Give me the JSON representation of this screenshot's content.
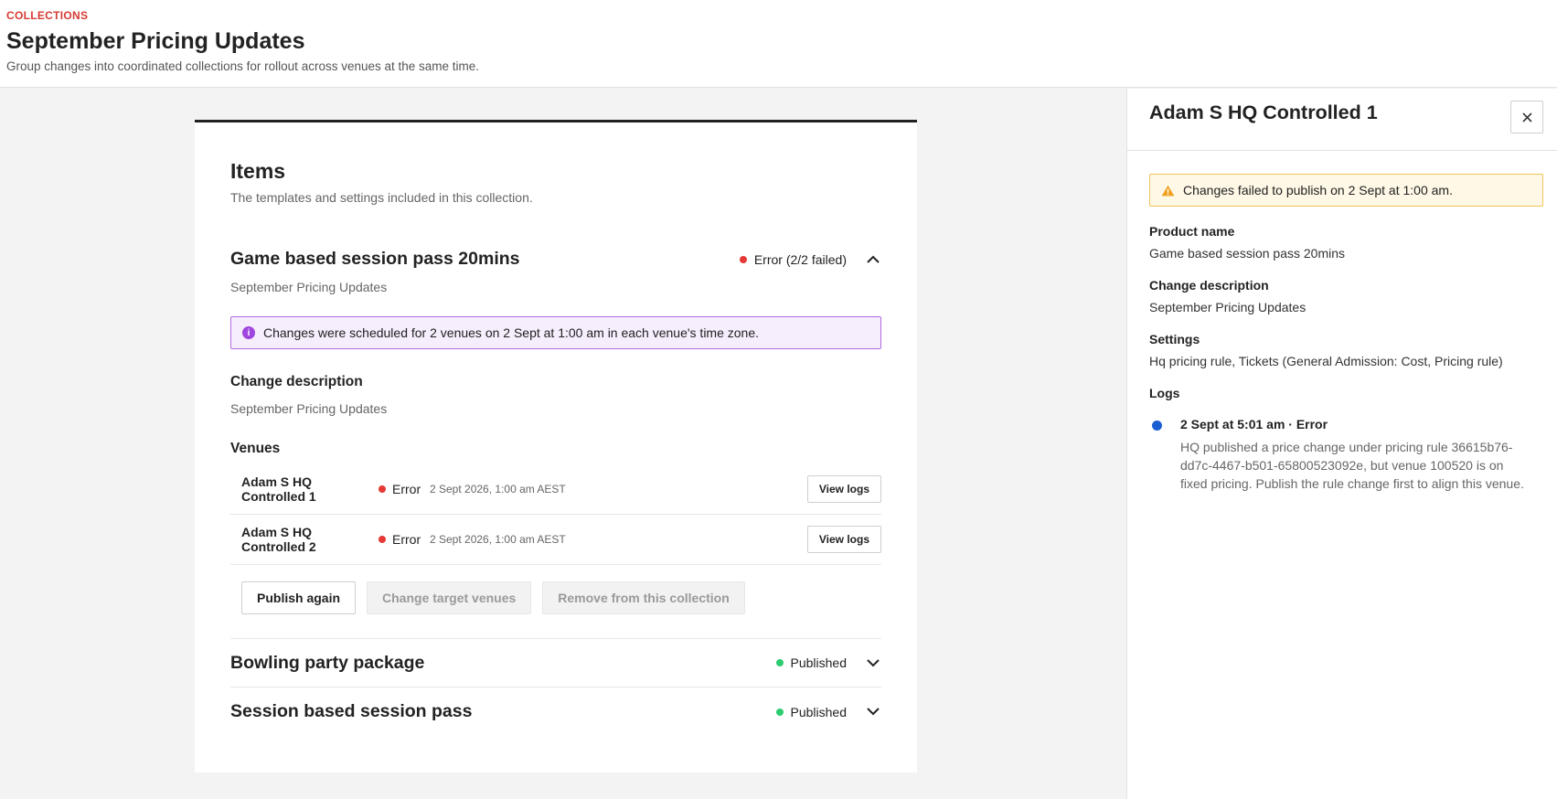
{
  "header": {
    "breadcrumb": "COLLECTIONS",
    "title": "September Pricing Updates",
    "subtitle": "Group changes into coordinated collections for rollout across venues at the same time."
  },
  "items_section": {
    "title": "Items",
    "subtitle": "The templates and settings included in this collection."
  },
  "expanded_item": {
    "title": "Game based session pass 20mins",
    "subtitle": "September Pricing Updates",
    "status": "Error (2/2 failed)",
    "status_color": "#e53935",
    "chevron_icon": "chevron-up-icon",
    "info_icon": "info-icon",
    "info_message": "Changes were scheduled for 2 venues on 2 Sept at 1:00 am in each venue's time zone.",
    "change_description_label": "Change description",
    "change_description": "September Pricing Updates",
    "venues_label": "Venues",
    "venues": [
      {
        "name": "Adam S HQ Controlled 1",
        "status": "Error",
        "date": "2 Sept 2026, 1:00 am AEST",
        "action": "View logs"
      },
      {
        "name": "Adam S HQ Controlled 2",
        "status": "Error",
        "date": "2 Sept 2026, 1:00 am AEST",
        "action": "View logs"
      }
    ],
    "actions": {
      "publish_again": "Publish again",
      "change_target_venues": "Change target venues",
      "remove_from_collection": "Remove from this collection"
    }
  },
  "collapsed_items": [
    {
      "title": "Bowling party package",
      "status": "Published",
      "status_color": "#2ecc71",
      "chevron_icon": "chevron-down-icon"
    },
    {
      "title": "Session based session pass",
      "status": "Published",
      "status_color": "#2ecc71",
      "chevron_icon": "chevron-down-icon"
    }
  ],
  "panel": {
    "title": "Adam S HQ Controlled 1",
    "close_icon": "close-icon",
    "warning_icon": "warning-icon",
    "warning": "Changes failed to publish on 2 Sept at 1:00 am.",
    "product_name_label": "Product name",
    "product_name": "Game based session pass 20mins",
    "change_description_label": "Change description",
    "change_description": "September Pricing Updates",
    "settings_label": "Settings",
    "settings": "Hq pricing rule, Tickets (General Admission: Cost, Pricing rule)",
    "logs_label": "Logs",
    "logs": [
      {
        "title": "2 Sept at 5:01 am · Error",
        "message": "HQ published a price change under pricing rule 36615b76-dd7c-4467-b501-65800523092e, but venue 100520 is on fixed pricing. Publish the rule change first to align this venue."
      }
    ]
  },
  "colors": {
    "accent_red": "#d63a32",
    "error": "#e53935",
    "success": "#2ecc71",
    "info_border": "#b36ae0",
    "warning_border": "#f1c45a",
    "log_dot": "#1a5fd1"
  }
}
